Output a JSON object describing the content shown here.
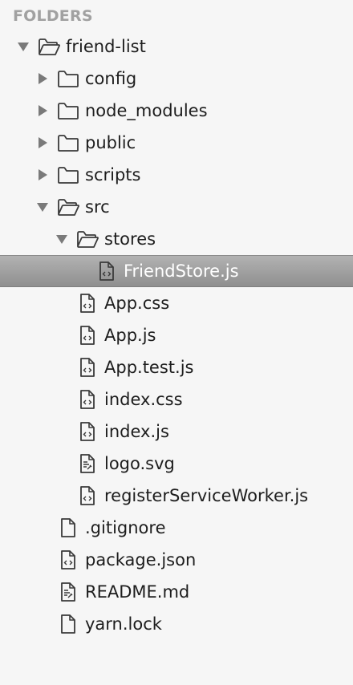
{
  "sidebar": {
    "header": "FOLDERS",
    "items": [
      {
        "label": "friend-list",
        "kind": "folder",
        "expanded": true,
        "depth": 0,
        "icon": "folder-open-icon"
      },
      {
        "label": "config",
        "kind": "folder",
        "expanded": false,
        "depth": 1,
        "icon": "folder-icon"
      },
      {
        "label": "node_modules",
        "kind": "folder",
        "expanded": false,
        "depth": 1,
        "icon": "folder-icon"
      },
      {
        "label": "public",
        "kind": "folder",
        "expanded": false,
        "depth": 1,
        "icon": "folder-icon"
      },
      {
        "label": "scripts",
        "kind": "folder",
        "expanded": false,
        "depth": 1,
        "icon": "folder-icon"
      },
      {
        "label": "src",
        "kind": "folder",
        "expanded": true,
        "depth": 1,
        "icon": "folder-open-icon"
      },
      {
        "label": "stores",
        "kind": "folder",
        "expanded": true,
        "depth": 2,
        "icon": "folder-open-icon"
      },
      {
        "label": "FriendStore.js",
        "kind": "file",
        "depth": 3,
        "icon": "code-file-icon",
        "selected": true
      },
      {
        "label": "App.css",
        "kind": "file",
        "depth": 2,
        "icon": "code-file-icon"
      },
      {
        "label": "App.js",
        "kind": "file",
        "depth": 2,
        "icon": "code-file-icon"
      },
      {
        "label": "App.test.js",
        "kind": "file",
        "depth": 2,
        "icon": "code-file-icon"
      },
      {
        "label": "index.css",
        "kind": "file",
        "depth": 2,
        "icon": "code-file-icon"
      },
      {
        "label": "index.js",
        "kind": "file",
        "depth": 2,
        "icon": "code-file-icon"
      },
      {
        "label": "logo.svg",
        "kind": "file",
        "depth": 2,
        "icon": "markup-file-icon"
      },
      {
        "label": "registerServiceWorker.js",
        "kind": "file",
        "depth": 2,
        "icon": "code-file-icon"
      },
      {
        "label": ".gitignore",
        "kind": "file",
        "depth": 1,
        "icon": "plain-file-icon"
      },
      {
        "label": "package.json",
        "kind": "file",
        "depth": 1,
        "icon": "code-file-icon"
      },
      {
        "label": "README.md",
        "kind": "file",
        "depth": 1,
        "icon": "markup-file-icon"
      },
      {
        "label": "yarn.lock",
        "kind": "file",
        "depth": 1,
        "icon": "plain-file-icon"
      }
    ]
  },
  "colors": {
    "background": "#f6f6f6",
    "header_text": "#a1a1a1",
    "selection_top": "#b2b2b2",
    "selection_bottom": "#8f8f8f",
    "selected_text": "#ffffff",
    "icon_stroke": "#3a3a3a"
  }
}
